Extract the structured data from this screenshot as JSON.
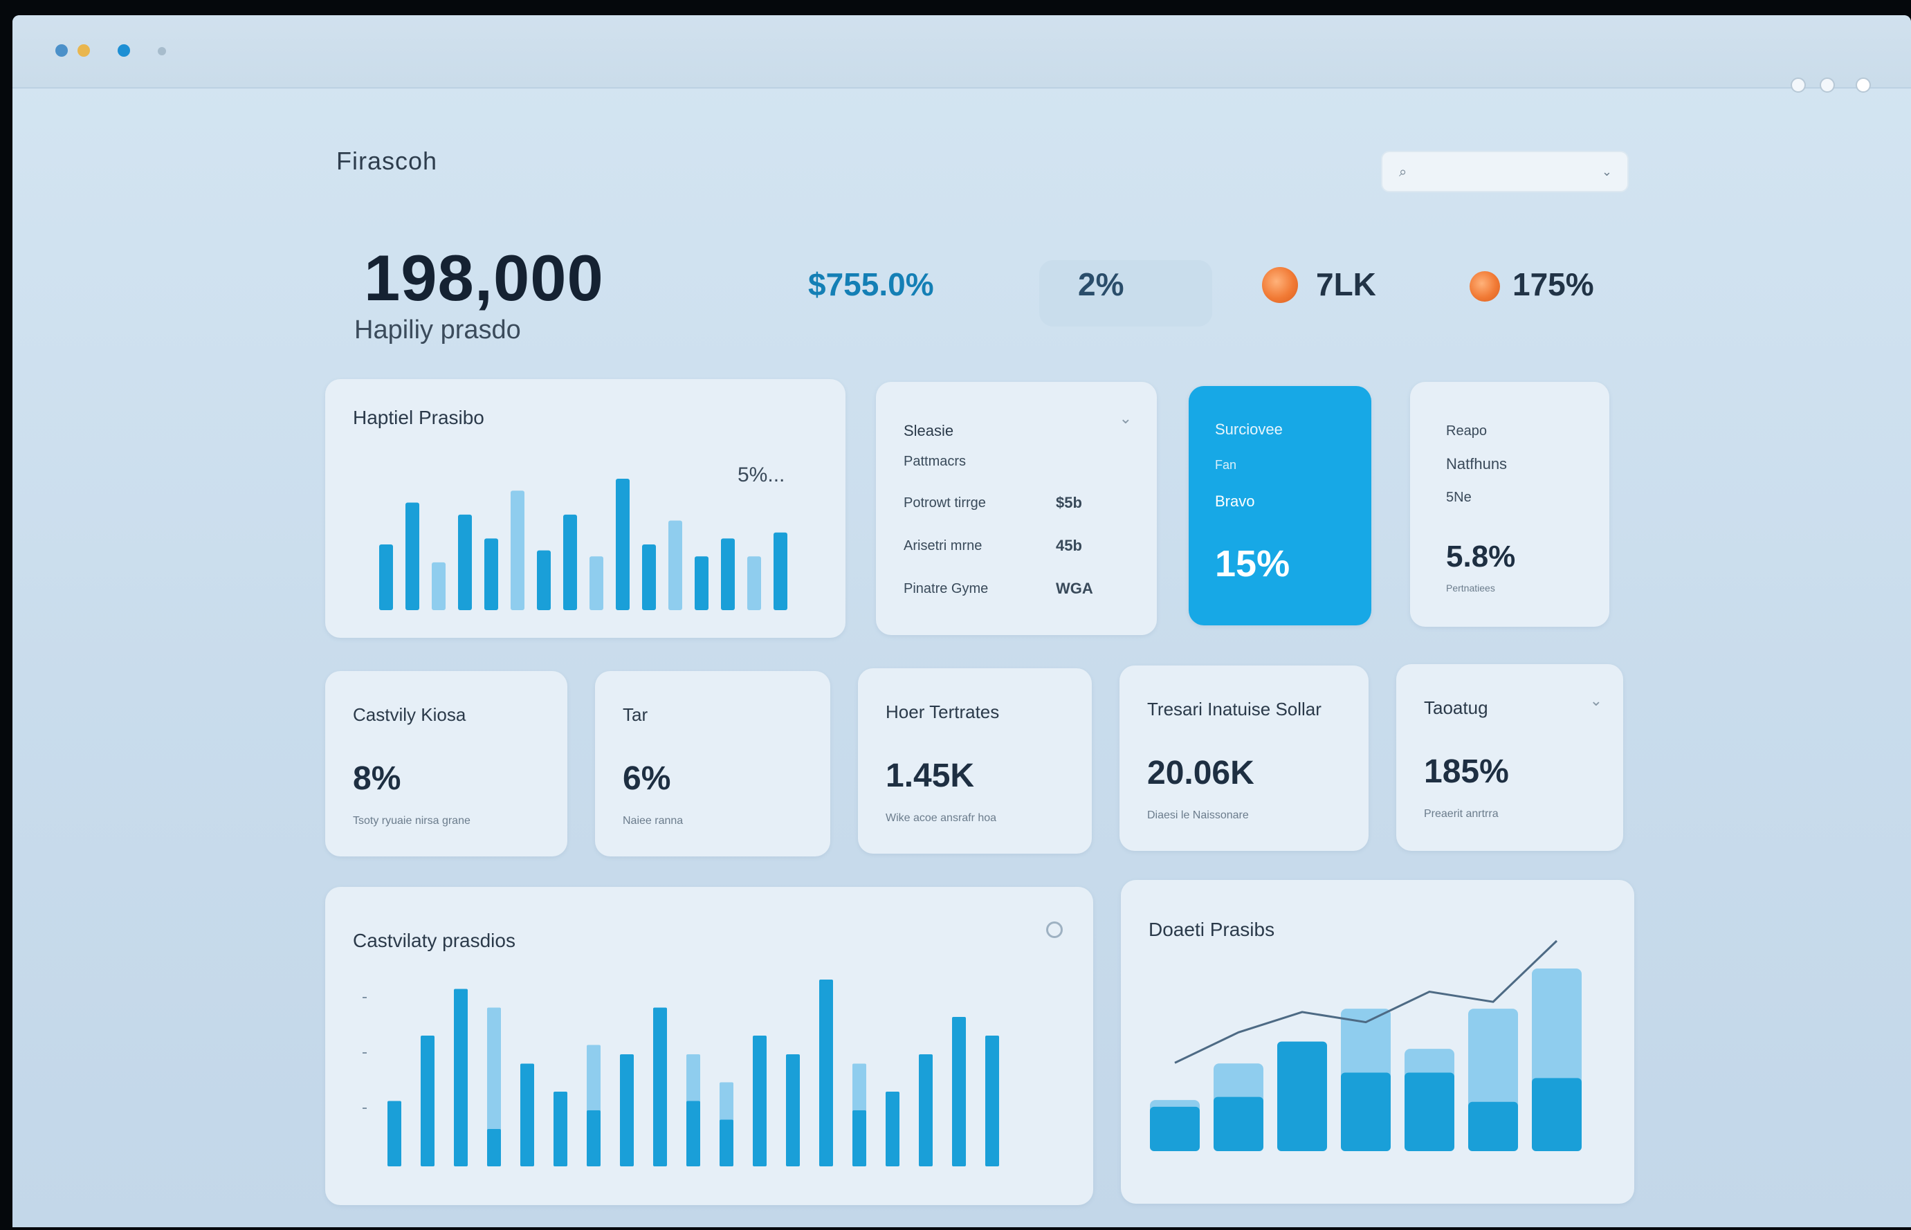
{
  "colors": {
    "accent": "#17a8e6",
    "bar_dark": "#1a9fd8",
    "bar_light": "#8fcdee",
    "orange": "#f17a35",
    "background": "#cfe1ef"
  },
  "header": {
    "brand": "Firascoh",
    "search_icon": "search-icon",
    "search_placeholder": "",
    "chevron_icon": "chevron-down-icon"
  },
  "hero": {
    "value": "198,000",
    "subtitle": "Hapiliy prasdo"
  },
  "kpis": [
    {
      "label": "$755.0%"
    },
    {
      "label": "2%"
    },
    {
      "label": "7LK"
    },
    {
      "label": "175%"
    }
  ],
  "top_cards": {
    "bar_card": {
      "title": "Haptiel Prasibo",
      "annotation": "5%..."
    },
    "list_card": {
      "title": "Sleasie",
      "subtitle": "Pattmacrs",
      "rows": [
        {
          "label": "Potrowt tirrge",
          "value": "$5b"
        },
        {
          "label": "Arisetri mrne",
          "value": "45b"
        },
        {
          "label": "Pinatre Gyme",
          "value": "WGA"
        }
      ]
    },
    "blue_card": {
      "title": "Surciovee",
      "line1": "Fan",
      "line2": "Bravo",
      "value": "15%"
    },
    "small_card": {
      "title": "Reapo",
      "line1": "Natfhuns",
      "line2": "5Ne",
      "value": "5.8%",
      "sub": "Pertnatiees"
    }
  },
  "stats": [
    {
      "title": "Castvily Kiosa",
      "value": "8%",
      "sub": "Tsoty ryuaie nirsa grane"
    },
    {
      "title": "Tar",
      "value": "6%",
      "sub": "Naiee ranna"
    },
    {
      "title": "Hoer Tertrates",
      "value": "1.45K",
      "sub": "Wike acoe ansrafr hoa"
    },
    {
      "title": "Tresari Inatuise Sollar",
      "value": "20.06K",
      "sub": "Diaesi le Naissonare"
    },
    {
      "title": "Taoatug",
      "value": "185%",
      "sub": "Preaerit anrtrra"
    }
  ],
  "bottom_cards": {
    "left_title": "Castvilaty prasdios",
    "right_title": "Doaeti Prasibs"
  },
  "chart_data": [
    {
      "type": "bar",
      "title": "Haptiel Prasibo",
      "series": [
        {
          "values": [
            0.55,
            0.9,
            0.4,
            0.8,
            0.6,
            1.0,
            0.5,
            0.8,
            0.45,
            1.1,
            0.55,
            0.75,
            0.45,
            0.6,
            0.45,
            0.65
          ]
        }
      ],
      "legend": false
    },
    {
      "type": "bar",
      "title": "Castvilaty prasdios",
      "series": [
        {
          "values": [
            0.35,
            0.7,
            0.95,
            0.2,
            0.55,
            0.4,
            0.3,
            0.6,
            0.85,
            0.35,
            0.25,
            0.7,
            0.6,
            1.0,
            0.3,
            0.4,
            0.6,
            0.8,
            0.7
          ]
        },
        {
          "values": [
            0,
            0,
            0,
            0.85,
            0,
            0.35,
            0.65,
            0,
            0,
            0.6,
            0.45,
            0,
            0,
            0,
            0.55,
            0,
            0,
            0,
            0
          ]
        }
      ],
      "legend": false
    },
    {
      "type": "bar",
      "title": "Doaeti Prasibs",
      "series": [
        {
          "values": [
            0.12,
            0.18,
            0.45,
            0.28,
            0.28,
            0.12,
            0.25
          ]
        },
        {
          "values": [
            0.28,
            0.48,
            0.6,
            0.78,
            0.56,
            0.78,
            1.0
          ]
        },
        {
          "values": [
            0.4,
            0.55,
            0.65,
            0.6,
            0.75,
            0.7,
            1.0
          ]
        }
      ],
      "legend": false
    }
  ]
}
